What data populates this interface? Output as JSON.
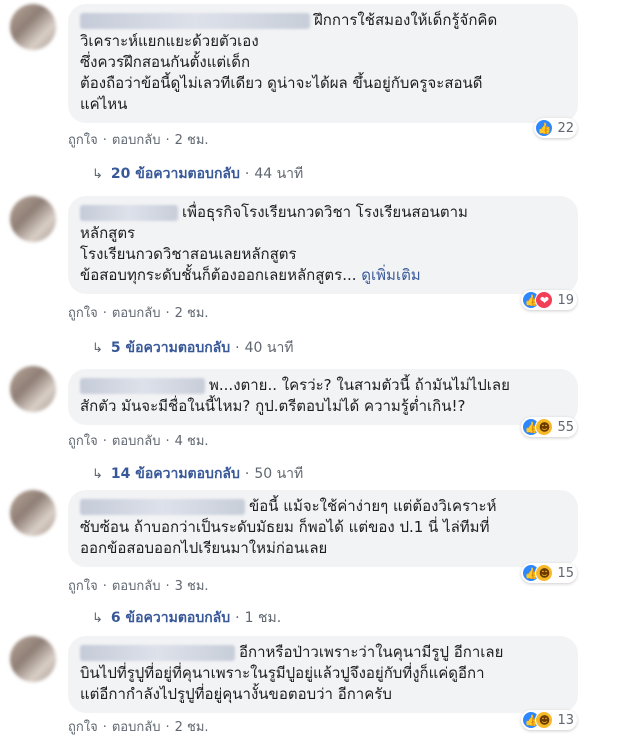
{
  "comments": [
    {
      "lines": [
        "ฝึกการใช้สมองให้เด็กรู้จักคิด",
        "วิเคราะห์แยกแยะด้วยตัวเอง",
        "ซึ่งควรฝึกสอนกันตั้งแต่เด็ก",
        "ต้องถือว่าข้อนี้ดูไม่เลวทีเดียว ดูน่าจะได้ผล ขึ้นอยู่กับครูจะสอนดี",
        "แค่ไหน"
      ],
      "like_label": "ถูกใจ",
      "reply_label": "ตอบกลับ",
      "time": "2 ชม.",
      "reaction_count": "22",
      "replies_count": "20 ข้อความตอบกลับ",
      "replies_time": "44 นาที"
    },
    {
      "lines": [
        "เพื่อธุรกิจโรงเรียนกวดวิชา โรงเรียนสอนตาม",
        "หลักสูตร",
        "โรงเรียนกวดวิชาสอนเลยหลักสูตร",
        "ข้อสอบทุกระดับชั้นก็ต้องออกเลยหลักสูตร..."
      ],
      "see_more": "ดูเพิ่มเติม",
      "like_label": "ถูกใจ",
      "reply_label": "ตอบกลับ",
      "time": "2 ชม.",
      "reaction_count": "19",
      "replies_count": "5 ข้อความตอบกลับ",
      "replies_time": "40 นาที"
    },
    {
      "lines": [
        "พ...งตาย.. ใครว่ะ? ในสามตัวนี้ ถ้ามันไม่ไปเลย",
        "สักตัว มันจะมีชื่อในนี้ไหม? กูป.ตรีตอบไม่ได้ ความรู้ต่ำเกิน!?"
      ],
      "like_label": "ถูกใจ",
      "reply_label": "ตอบกลับ",
      "time": "4 ชม.",
      "reaction_count": "55",
      "replies_count": "14 ข้อความตอบกลับ",
      "replies_time": "50 นาที"
    },
    {
      "lines": [
        "ข้อนี้ แม้จะใช้ค่าง่ายๆ แต่ต้องวิเคราะห์",
        "ซับซ้อน ถ้าบอกว่าเป็นระดับมัธยม ก็พอได้ แต่ของ ป.1 นี่ ไล่ทีมที่",
        "ออกข้อสอบออกไปเรียนมาใหม่ก่อนเลย"
      ],
      "like_label": "ถูกใจ",
      "reply_label": "ตอบกลับ",
      "time": "3 ชม.",
      "reaction_count": "15",
      "replies_count": "6 ข้อความตอบกลับ",
      "replies_time": "1 ชม."
    },
    {
      "lines": [
        "อีกาหรือป่าวเพราะว่าในคุนามีรูปู อีกาเลย",
        "บินไปที่รูปูที่อยู่ที่คุนาเพราะในรูมีปูอยู่แล้วปูจึงอยู่กับที่งูก็แค่ดูอีกา",
        "แต่อีกากำลังไปรูปูที่อยู่คุนางั้นขอตอบว่า อีกาครับ"
      ],
      "like_label": "ถูกใจ",
      "reply_label": "ตอบกลับ",
      "time": "2 ชม.",
      "reaction_count": "13"
    }
  ],
  "colors": {
    "link": "#385898",
    "bubble": "#f2f3f5",
    "like": "#2d88ff",
    "love": "#f33e58",
    "haha": "#f7b928"
  }
}
